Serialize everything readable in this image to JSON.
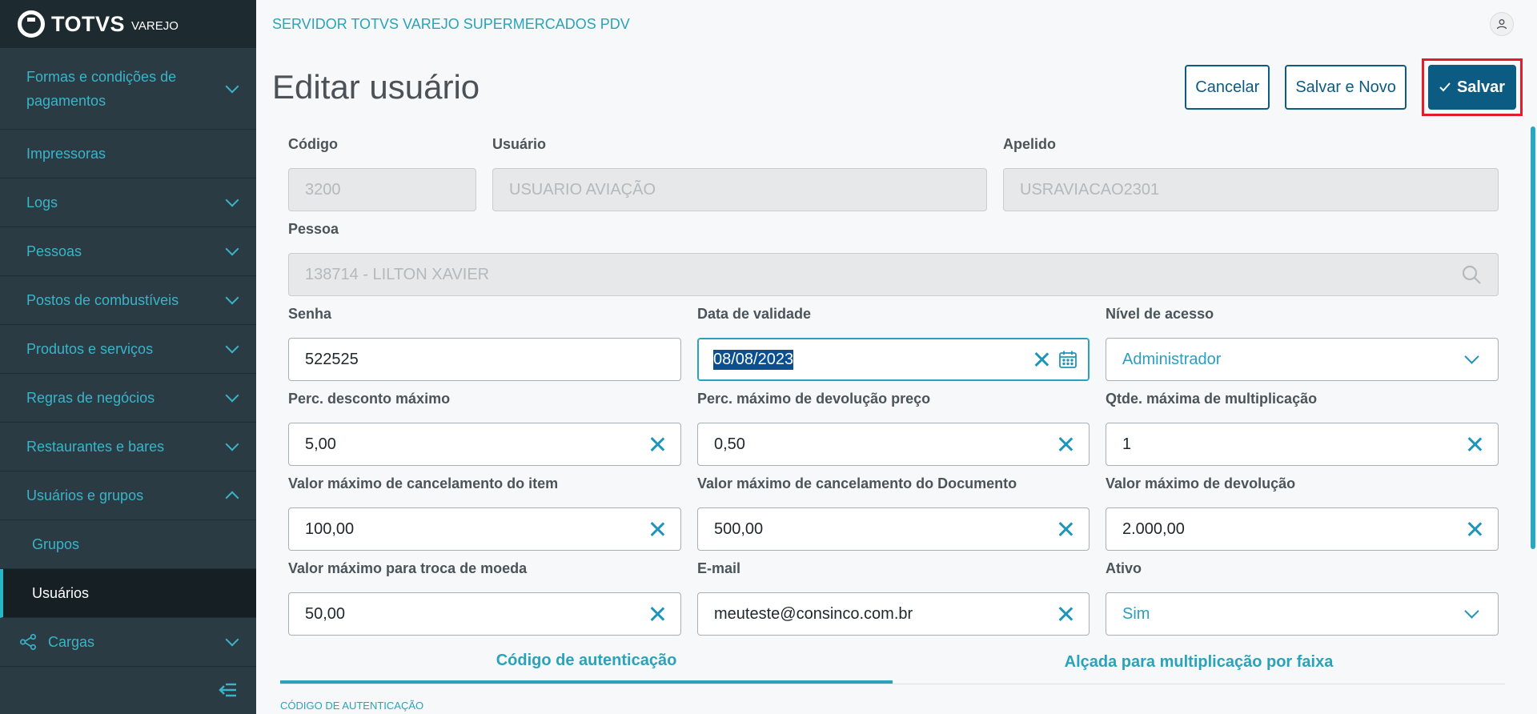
{
  "brand": {
    "name": "TOTVS",
    "sub": "VAREJO"
  },
  "sidebar": {
    "items": [
      {
        "label": "Formas e condições de pagamentos",
        "expandable": true
      },
      {
        "label": "Impressoras",
        "expandable": false
      },
      {
        "label": "Logs",
        "expandable": true
      },
      {
        "label": "Pessoas",
        "expandable": true
      },
      {
        "label": "Postos de combustíveis",
        "expandable": true
      },
      {
        "label": "Produtos e serviços",
        "expandable": true
      },
      {
        "label": "Regras de negócios",
        "expandable": true
      },
      {
        "label": "Restaurantes e bares",
        "expandable": true
      },
      {
        "label": "Usuários e grupos",
        "expandable": true,
        "expanded": true
      }
    ],
    "sub_items": [
      {
        "label": "Grupos"
      },
      {
        "label": "Usuários",
        "active": true
      }
    ],
    "cargas": "Cargas"
  },
  "header": {
    "server": "SERVIDOR TOTVS VAREJO SUPERMERCADOS PDV"
  },
  "page": {
    "title": "Editar usuário",
    "cancel": "Cancelar",
    "save_new": "Salvar e Novo",
    "save": "Salvar"
  },
  "form": {
    "codigo": {
      "label": "Código",
      "value": "3200"
    },
    "usuario": {
      "label": "Usuário",
      "value": "USUARIO AVIAÇÃO"
    },
    "apelido": {
      "label": "Apelido",
      "value": "USRAVIACAO2301"
    },
    "pessoa": {
      "label": "Pessoa",
      "value": "138714 - LILTON XAVIER"
    },
    "senha": {
      "label": "Senha",
      "value": "522525"
    },
    "data_validade": {
      "label": "Data de validade",
      "value": "08/08/2023"
    },
    "nivel_acesso": {
      "label": "Nível de acesso",
      "value": "Administrador"
    },
    "perc_desconto": {
      "label": "Perc. desconto máximo",
      "value": "5,00"
    },
    "perc_devolucao": {
      "label": "Perc. máximo de devolução preço",
      "value": "0,50"
    },
    "qtde_mult": {
      "label": "Qtde. máxima de multiplicação",
      "value": "1"
    },
    "canc_item": {
      "label": "Valor máximo de cancelamento do item",
      "value": "100,00"
    },
    "canc_doc": {
      "label": "Valor máximo de cancelamento do Documento",
      "value": "500,00"
    },
    "max_devolucao": {
      "label": "Valor máximo de devolução",
      "value": "2.000,00"
    },
    "troca_moeda": {
      "label": "Valor máximo para troca de moeda",
      "value": "50,00"
    },
    "email": {
      "label": "E-mail",
      "value": "meuteste@consinco.com.br"
    },
    "ativo": {
      "label": "Ativo",
      "value": "Sim"
    }
  },
  "tabs": [
    {
      "label": "Código de autenticação",
      "active": true
    },
    {
      "label": "Alçada para multiplicação por faixa",
      "active": false
    }
  ],
  "section_label": "CÓDIGO DE AUTENTICAÇÃO",
  "colors": {
    "accent": "#29b6c5",
    "primary": "#0c5b83",
    "highlight": "#e21d2a",
    "sidebar": "#2b3b43"
  }
}
